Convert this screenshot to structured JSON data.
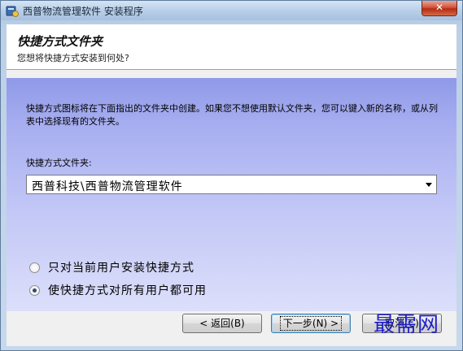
{
  "window": {
    "title": "西普物流管理软件 安装程序",
    "close_label": "✕"
  },
  "header": {
    "title": "快捷方式文件夹",
    "subtitle": "您想将快捷方式安装到何处?"
  },
  "main": {
    "description": "快捷方式图标将在下面指出的文件夹中创建。如果您不想使用默认文件夹，您可以键入新的名称，或从列表中选择现有的文件夹。",
    "folder_label": "快捷方式文件夹:",
    "folder_value": "西普科技\\西普物流管理软件",
    "radio_options": [
      {
        "label": "只对当前用户安装快捷方式",
        "checked": false
      },
      {
        "label": "使快捷方式对所有用户都可用",
        "checked": true
      }
    ]
  },
  "buttons": {
    "back": "< 返回(B)",
    "next": "下一步(N) >",
    "cancel": "取消(C)"
  },
  "watermark": "最需网",
  "colors": {
    "panel_gradient_top": "#8f99e8",
    "panel_gradient_bottom": "#dcdffa",
    "watermark": "#1e1ec8",
    "close_button": "#c8452b"
  },
  "icons": {
    "app_icon": "installer-icon",
    "combo_arrow": "chevron-down-icon"
  }
}
